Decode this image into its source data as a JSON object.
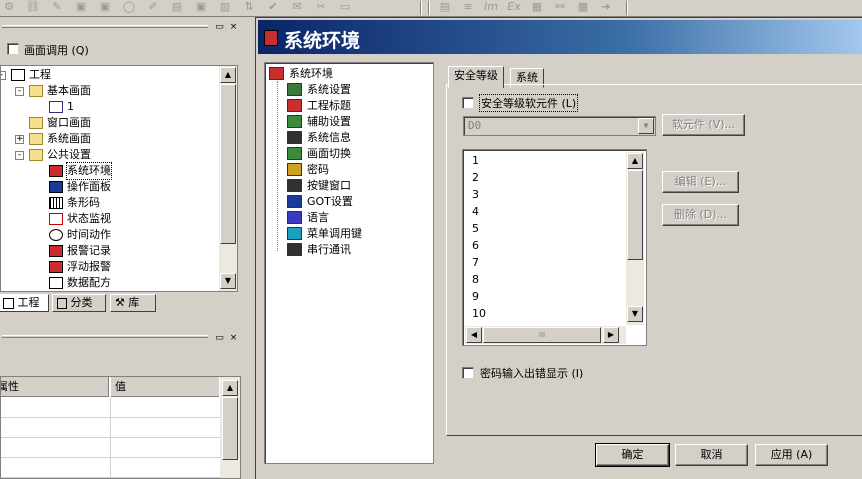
{
  "toolbar": {
    "left_icons": [
      "gear-icon",
      "link-icon",
      "draw-icon",
      "image-icon",
      "image2-icon",
      "circle-icon",
      "edit-icon",
      "report-icon",
      "image3-icon",
      "graph-icon",
      "sort-icon",
      "check-icon",
      "email-icon",
      "cut-icon",
      "tab-icon"
    ],
    "right_icons": [
      "document-icon",
      "list-icon",
      "lm-icon",
      "ex-icon",
      "find-icon",
      "group-icon",
      "tool-icon",
      "arrow-right-icon"
    ],
    "right_labels": [
      "",
      "",
      "Im",
      "Ex",
      "",
      "",
      "",
      ""
    ]
  },
  "project_panel": {
    "screen_call_label": "画面调用 (Q)",
    "tree": [
      {
        "label": "工程",
        "level": 0,
        "expander": "-",
        "icon": "project"
      },
      {
        "label": "基本画面",
        "level": 1,
        "expander": "-",
        "icon": "folder"
      },
      {
        "label": "1",
        "level": 2,
        "expander": "",
        "icon": "screen"
      },
      {
        "label": "窗口画面",
        "level": 1,
        "expander": "",
        "icon": "folder"
      },
      {
        "label": "系统画面",
        "level": 1,
        "expander": "+",
        "icon": "folder"
      },
      {
        "label": "公共设置",
        "level": 1,
        "expander": "-",
        "icon": "folder"
      },
      {
        "label": "系统环境",
        "level": 2,
        "expander": "",
        "icon": "setting"
      },
      {
        "label": "操作面板",
        "level": 2,
        "expander": "",
        "icon": "panel"
      },
      {
        "label": "条形码",
        "level": 2,
        "expander": "",
        "icon": "barcode"
      },
      {
        "label": "状态监视",
        "level": 2,
        "expander": "",
        "icon": "monitor"
      },
      {
        "label": "时间动作",
        "level": 2,
        "expander": "",
        "icon": "clock"
      },
      {
        "label": "报警记录",
        "level": 2,
        "expander": "",
        "icon": "alarm"
      },
      {
        "label": "浮动报警",
        "level": 2,
        "expander": "",
        "icon": "alarm2"
      },
      {
        "label": "数据配方",
        "level": 2,
        "expander": "",
        "icon": "recipe"
      }
    ],
    "tabs": [
      "工程",
      "分类",
      "库"
    ]
  },
  "property_panel": {
    "headers": [
      "属性",
      "值"
    ]
  },
  "dialog": {
    "title": "系统环境",
    "nav": [
      {
        "label": "系统环境",
        "icon": "setting",
        "color": "#c83030"
      },
      {
        "label": "系统设置",
        "icon": "setting",
        "color": "#3a7a3a"
      },
      {
        "label": "工程标题",
        "icon": "title",
        "color": "#c83030"
      },
      {
        "label": "辅助设置",
        "icon": "aux",
        "color": "#3a8a3a"
      },
      {
        "label": "系统信息",
        "icon": "info",
        "color": "#303030"
      },
      {
        "label": "画面切换",
        "icon": "switch",
        "color": "#3a8a3a"
      },
      {
        "label": "密码",
        "icon": "lock",
        "color": "#d0a020"
      },
      {
        "label": "按键窗口",
        "icon": "keypad",
        "color": "#303030"
      },
      {
        "label": "GOT设置",
        "icon": "got",
        "color": "#1a3a9a"
      },
      {
        "label": "语言",
        "icon": "language",
        "color": "#3a3ac0"
      },
      {
        "label": "菜单调用键",
        "icon": "menu",
        "color": "#1aa0c0"
      },
      {
        "label": "串行通讯",
        "icon": "serial",
        "color": "#303030"
      }
    ],
    "tabs": [
      "安全等级",
      "系统"
    ],
    "security_device_label": "安全等级软元件 (L)",
    "device_value": "D0",
    "device_button": "软元件 (V)...",
    "levels": [
      "1",
      "2",
      "3",
      "4",
      "5",
      "6",
      "7",
      "8",
      "9",
      "10"
    ],
    "edit_button": "编辑 (E)...",
    "delete_button": "删除 (D)...",
    "password_error_label": "密码输入出错显示 (I)",
    "ok_button": "确定",
    "cancel_button": "取消",
    "apply_button": "应用 (A)"
  }
}
